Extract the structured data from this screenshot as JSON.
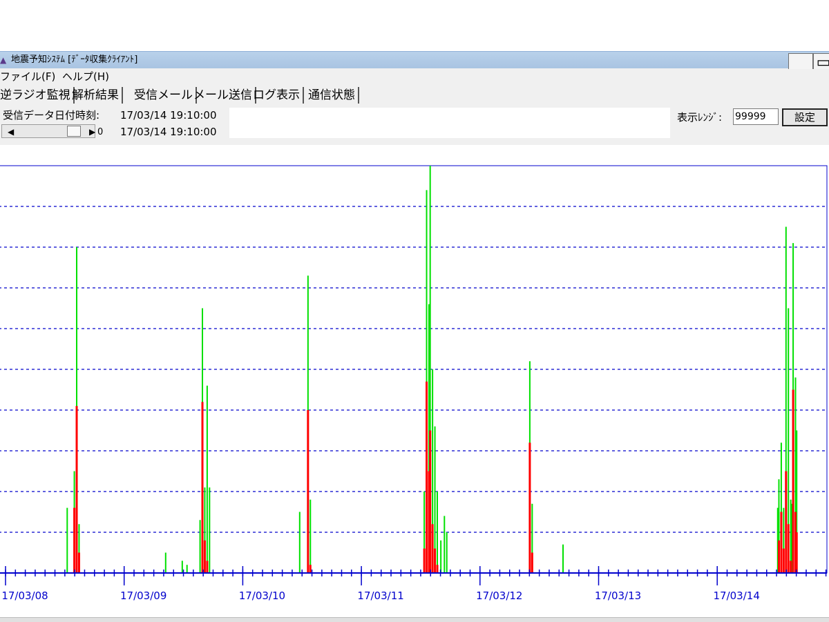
{
  "window": {
    "title": "地震予知ｼｽﾃﾑ [ﾃﾞｰﾀ収集ｸﾗｲｱﾝﾄ]",
    "icon": "app-icon",
    "minimize_label": "_",
    "restore_label": "▭"
  },
  "menu": {
    "items": [
      "ファイル(F)",
      "ヘルプ(H)"
    ]
  },
  "tabs": [
    {
      "label": "逆ラジオ監視",
      "active": true
    },
    {
      "label": "解析結果",
      "active": false
    },
    {
      "label": "受信メール",
      "active": false
    },
    {
      "label": "メール送信",
      "active": false
    },
    {
      "label": "ログ表示",
      "active": false
    },
    {
      "label": "通信状態",
      "active": false
    }
  ],
  "info": {
    "recv_label": "受信データ日付時刻:",
    "recv_value": "17/03/14 19:10:00",
    "slider_value": "17/03/14 19:10:00",
    "slider_min": "0",
    "slider_position": 0.85
  },
  "range": {
    "label": "表示ﾚﾝｼﾞ:",
    "value": "99999",
    "button_label": "設定"
  },
  "colors": {
    "axis": "#0000cc",
    "grid": "#0000cc",
    "series_green": "#00e000",
    "series_red": "#ff0000"
  },
  "chart_data": {
    "type": "bar",
    "x_tick_labels": [
      "17/03/08",
      "17/03/09",
      "17/03/10",
      "17/03/11",
      "17/03/12",
      "17/03/13",
      "17/03/14"
    ],
    "ylim": [
      0,
      10
    ],
    "grid": true,
    "series": [
      {
        "color": "green",
        "points": [
          [
            0.52,
            1.6
          ],
          [
            0.58,
            2.5
          ],
          [
            0.6,
            8.0
          ],
          [
            0.62,
            1.2
          ],
          [
            1.35,
            0.5
          ],
          [
            1.49,
            0.3
          ],
          [
            1.53,
            0.2
          ],
          [
            1.64,
            1.3
          ],
          [
            1.66,
            6.5
          ],
          [
            1.68,
            2.1
          ],
          [
            1.7,
            4.6
          ],
          [
            1.72,
            2.1
          ],
          [
            2.48,
            1.5
          ],
          [
            2.55,
            7.3
          ],
          [
            2.57,
            1.8
          ],
          [
            3.53,
            2.0
          ],
          [
            3.55,
            9.4
          ],
          [
            3.57,
            6.6
          ],
          [
            3.58,
            10.0
          ],
          [
            3.6,
            5.0
          ],
          [
            3.62,
            3.6
          ],
          [
            3.64,
            2.0
          ],
          [
            3.67,
            0.8
          ],
          [
            3.7,
            1.4
          ],
          [
            3.72,
            1.0
          ],
          [
            4.42,
            5.2
          ],
          [
            4.44,
            1.7
          ],
          [
            4.7,
            0.7
          ],
          [
            6.51,
            1.6
          ],
          [
            6.52,
            2.3
          ],
          [
            6.54,
            3.2
          ],
          [
            6.56,
            1.6
          ],
          [
            6.58,
            8.5
          ],
          [
            6.6,
            6.5
          ],
          [
            6.62,
            1.8
          ],
          [
            6.63,
            1.7
          ],
          [
            6.64,
            8.1
          ],
          [
            6.66,
            4.8
          ],
          [
            6.67,
            3.5
          ]
        ]
      },
      {
        "color": "red",
        "points": [
          [
            0.58,
            1.6
          ],
          [
            0.6,
            4.1
          ],
          [
            0.62,
            0.5
          ],
          [
            1.66,
            4.2
          ],
          [
            1.68,
            0.8
          ],
          [
            1.7,
            0.3
          ],
          [
            2.55,
            4.0
          ],
          [
            2.57,
            0.2
          ],
          [
            3.53,
            0.6
          ],
          [
            3.55,
            4.7
          ],
          [
            3.57,
            2.5
          ],
          [
            3.58,
            3.5
          ],
          [
            3.6,
            1.2
          ],
          [
            3.62,
            0.6
          ],
          [
            3.64,
            0.2
          ],
          [
            4.42,
            3.2
          ],
          [
            4.44,
            0.5
          ],
          [
            6.52,
            0.8
          ],
          [
            6.54,
            1.5
          ],
          [
            6.56,
            0.6
          ],
          [
            6.58,
            2.5
          ],
          [
            6.6,
            1.2
          ],
          [
            6.62,
            0.3
          ],
          [
            6.64,
            4.5
          ],
          [
            6.66,
            1.5
          ],
          [
            6.67,
            1.0
          ]
        ]
      }
    ]
  }
}
